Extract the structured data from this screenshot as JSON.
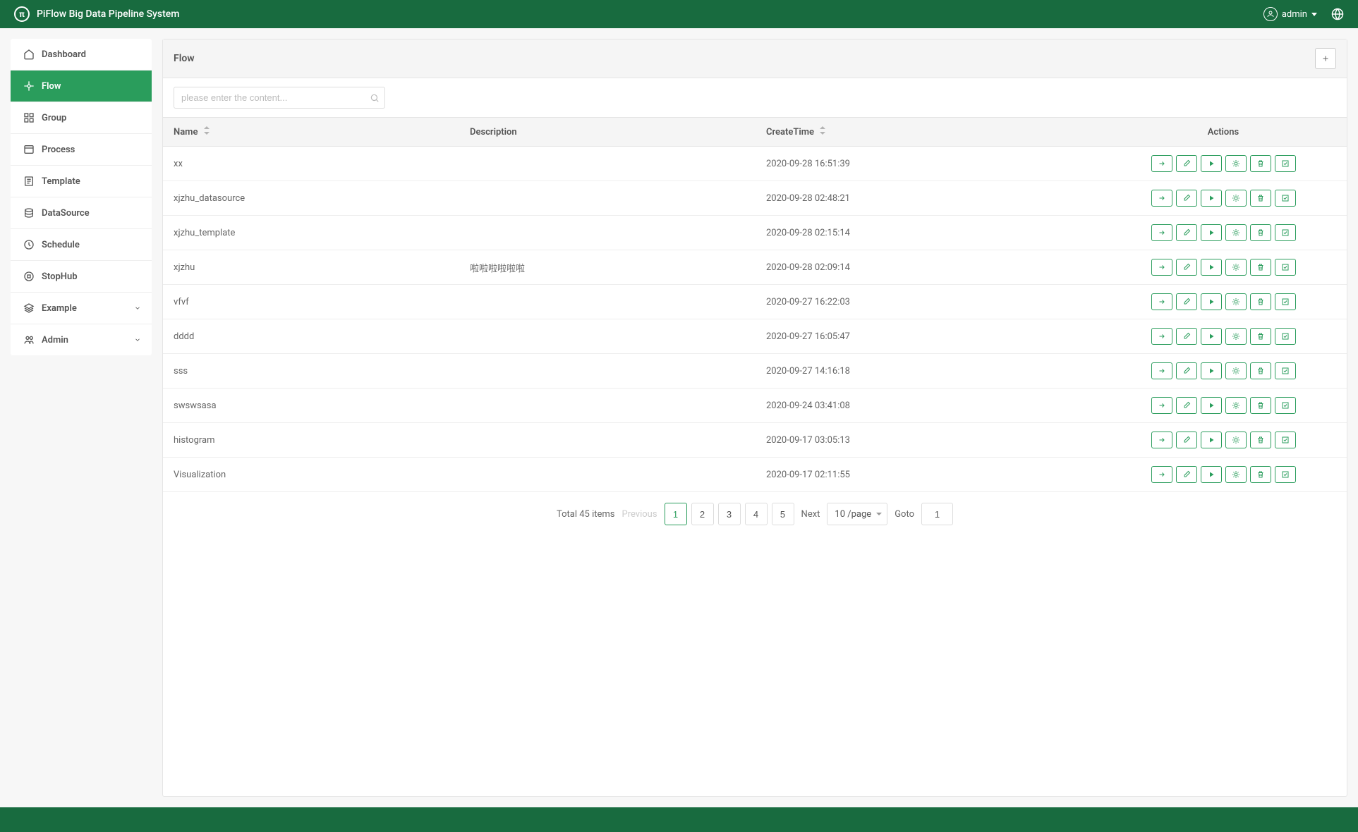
{
  "header": {
    "title": "PiFlow Big Data Pipeline System",
    "user": "admin"
  },
  "sidebar": {
    "items": [
      {
        "label": "Dashboard",
        "icon": "home"
      },
      {
        "label": "Flow",
        "icon": "flow"
      },
      {
        "label": "Group",
        "icon": "group"
      },
      {
        "label": "Process",
        "icon": "process"
      },
      {
        "label": "Template",
        "icon": "template"
      },
      {
        "label": "DataSource",
        "icon": "datasource"
      },
      {
        "label": "Schedule",
        "icon": "schedule"
      },
      {
        "label": "StopHub",
        "icon": "stophub"
      },
      {
        "label": "Example",
        "icon": "example",
        "expandable": true
      },
      {
        "label": "Admin",
        "icon": "admin",
        "expandable": true
      }
    ]
  },
  "panel": {
    "title": "Flow",
    "search_placeholder": "please enter the content..."
  },
  "table": {
    "columns": {
      "name": "Name",
      "description": "Description",
      "createtime": "CreateTime",
      "actions": "Actions"
    },
    "rows": [
      {
        "name": "xx",
        "description": "",
        "createtime": "2020-09-28 16:51:39"
      },
      {
        "name": "xjzhu_datasource",
        "description": "",
        "createtime": "2020-09-28 02:48:21"
      },
      {
        "name": "xjzhu_template",
        "description": "",
        "createtime": "2020-09-28 02:15:14"
      },
      {
        "name": "xjzhu",
        "description": "啦啦啦啦啦啦",
        "createtime": "2020-09-28 02:09:14"
      },
      {
        "name": "vfvf",
        "description": "",
        "createtime": "2020-09-27 16:22:03"
      },
      {
        "name": "dddd",
        "description": "",
        "createtime": "2020-09-27 16:05:47"
      },
      {
        "name": "sss",
        "description": "",
        "createtime": "2020-09-27 14:16:18"
      },
      {
        "name": "swswsasa",
        "description": "",
        "createtime": "2020-09-24 03:41:08"
      },
      {
        "name": "histogram",
        "description": "",
        "createtime": "2020-09-17 03:05:13"
      },
      {
        "name": "Visualization",
        "description": "",
        "createtime": "2020-09-17 02:11:55"
      }
    ]
  },
  "pagination": {
    "total_label": "Total 45 items",
    "previous": "Previous",
    "next": "Next",
    "pages": [
      "1",
      "2",
      "3",
      "4",
      "5"
    ],
    "current": "1",
    "per_page": "10 /page",
    "goto_label": "Goto",
    "goto_value": "1"
  }
}
